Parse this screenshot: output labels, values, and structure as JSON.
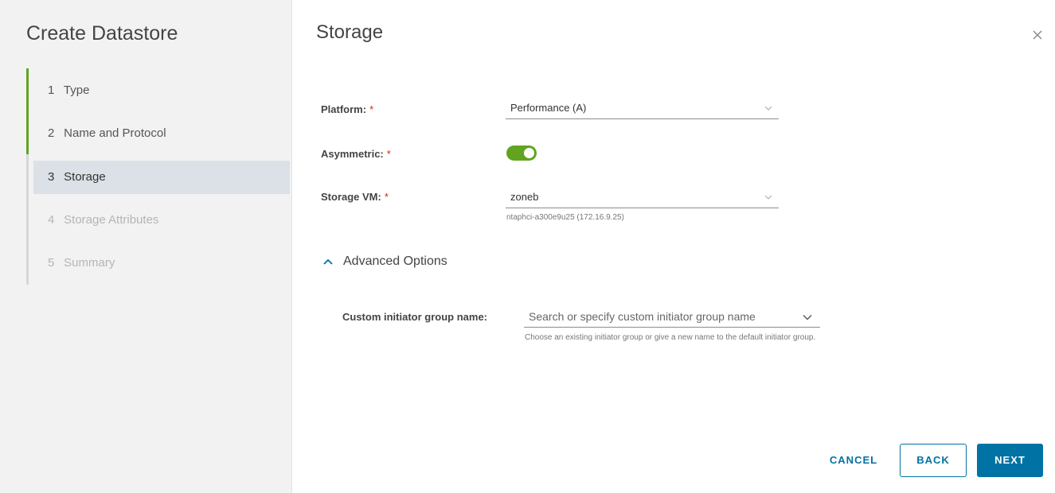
{
  "wizard": {
    "title": "Create Datastore",
    "steps": [
      {
        "number": "1",
        "label": "Type",
        "state": "completed"
      },
      {
        "number": "2",
        "label": "Name and Protocol",
        "state": "completed"
      },
      {
        "number": "3",
        "label": "Storage",
        "state": "active"
      },
      {
        "number": "4",
        "label": "Storage Attributes",
        "state": "disabled"
      },
      {
        "number": "5",
        "label": "Summary",
        "state": "disabled"
      }
    ]
  },
  "page": {
    "title": "Storage",
    "close_icon": "close-icon"
  },
  "form": {
    "platform": {
      "label": "Platform:",
      "required_mark": "*",
      "value": "Performance (A)"
    },
    "asymmetric": {
      "label": "Asymmetric:",
      "required_mark": "*",
      "enabled": true
    },
    "storage_vm": {
      "label": "Storage VM:",
      "required_mark": "*",
      "value": "zoneb",
      "helper": "ntaphci-a300e9u25 (172.16.9.25)"
    },
    "advanced": {
      "label": "Advanced Options",
      "expanded": true
    },
    "initiator_group": {
      "label": "Custom initiator group name:",
      "placeholder": "Search or specify custom initiator group name",
      "helper": "Choose an existing initiator group or give a new name to the default initiator group."
    }
  },
  "actions": {
    "cancel": "CANCEL",
    "back": "BACK",
    "next": "NEXT"
  },
  "colors": {
    "accent": "#0072a3",
    "progress": "#62a420",
    "required": "#e12200",
    "active_step_bg": "#dbe1e6",
    "sidebar_bg": "#f2f2f2"
  }
}
